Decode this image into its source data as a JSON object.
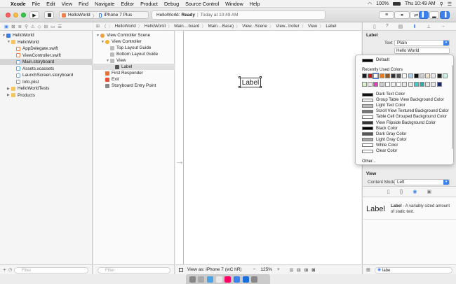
{
  "menubar": {
    "apple": "",
    "app": "Xcode",
    "items": [
      "File",
      "Edit",
      "View",
      "Find",
      "Navigate",
      "Editor",
      "Product",
      "Debug",
      "Source Control",
      "Window",
      "Help"
    ],
    "battery": "100%",
    "clock": "Thu 10:49 AM"
  },
  "toolbar": {
    "scheme_project": "HelloWorld",
    "scheme_device": "iPhone 7 Plus",
    "status_project": "HelloWorld:",
    "status_state": "Ready",
    "status_sep": "|",
    "status_time": "Today at 10:49 AM"
  },
  "navigator": {
    "rows": [
      {
        "label": "HelloWorld",
        "indent": 0,
        "kind": "proj",
        "disclosure": "▼",
        "selected": false
      },
      {
        "label": "HelloWorld",
        "indent": 1,
        "kind": "folder",
        "disclosure": "▼",
        "selected": false
      },
      {
        "label": "AppDelegate.swift",
        "indent": 2,
        "kind": "swift",
        "disclosure": "",
        "selected": false
      },
      {
        "label": "ViewController.swift",
        "indent": 2,
        "kind": "swift",
        "disclosure": "",
        "selected": false
      },
      {
        "label": "Main.storyboard",
        "indent": 2,
        "kind": "story",
        "disclosure": "",
        "selected": true
      },
      {
        "label": "Assets.xcassets",
        "indent": 2,
        "kind": "xcass",
        "disclosure": "",
        "selected": false
      },
      {
        "label": "LaunchScreen.storyboard",
        "indent": 2,
        "kind": "story",
        "disclosure": "",
        "selected": false
      },
      {
        "label": "Info.plist",
        "indent": 2,
        "kind": "plist",
        "disclosure": "",
        "selected": false
      },
      {
        "label": "HelloWorldTests",
        "indent": 1,
        "kind": "folder",
        "disclosure": "▶",
        "selected": false
      },
      {
        "label": "Products",
        "indent": 1,
        "kind": "folder",
        "disclosure": "▶",
        "selected": false
      }
    ],
    "filter_placeholder": "Filter"
  },
  "jumpbar": {
    "crumbs": [
      "HelloWorld",
      "HelloWorld",
      "Main....board",
      "Main....Base)",
      "View...Scene",
      "View...troller",
      "View",
      "Label"
    ]
  },
  "outline": {
    "rows": [
      {
        "label": "View Controller Scene",
        "indent": 0,
        "disclosure": "▼",
        "icon": "#f0a040",
        "selected": false
      },
      {
        "label": "View Controller",
        "indent": 1,
        "disclosure": "▼",
        "icon": "#f2b233",
        "selected": false
      },
      {
        "label": "Top Layout Guide",
        "indent": 2,
        "disclosure": "",
        "icon": "#bbbbbb",
        "selected": false
      },
      {
        "label": "Bottom Layout Guide",
        "indent": 2,
        "disclosure": "",
        "icon": "#bbbbbb",
        "selected": false
      },
      {
        "label": "View",
        "indent": 2,
        "disclosure": "▼",
        "icon": "#bbbbbb",
        "selected": false
      },
      {
        "label": "Label",
        "indent": 3,
        "disclosure": "",
        "icon": "#555555",
        "selected": true
      },
      {
        "label": "First Responder",
        "indent": 1,
        "disclosure": "",
        "icon": "#e8703a",
        "selected": false
      },
      {
        "label": "Exit",
        "indent": 1,
        "disclosure": "",
        "icon": "#e8503a",
        "selected": false
      },
      {
        "label": "Storyboard Entry Point",
        "indent": 1,
        "disclosure": "",
        "icon": "#888888",
        "selected": false
      }
    ],
    "filter_placeholder": "Filter"
  },
  "canvas": {
    "label_text": "Label",
    "view_as": "View as: iPhone 7 (wC hR)",
    "zoom": "125%"
  },
  "inspector": {
    "section": "Label",
    "text_label": "Text",
    "text_value": "Plain",
    "text_content": "Hello World",
    "view_section": "View",
    "content_mode_label": "Content Mode",
    "content_mode_value": "Left"
  },
  "color_popover": {
    "default_label": "Default",
    "recent_header": "Recently Used Colors",
    "recent_colors_row1": [
      "#1a1a1a",
      "#c41f1f",
      "#ffffff",
      "#e67e22",
      "#8a5a2b",
      "#333333",
      "#555555",
      "#ffffff",
      "#a9d0f5",
      "#111111",
      "#cfcfcf",
      "#f5e6c8",
      "#e9e9e9",
      "#222222",
      "#c9f2e6"
    ],
    "recent_colors_row2": [
      "#d9f5c4",
      "#e9e9e9",
      "#e040c0",
      "#d0d0d0",
      "#ffffff",
      "#f0f0f0",
      "#ffffff",
      "#e9e9e9",
      "#e9e9e9",
      "#3bd0d0",
      "#2bb0b0",
      "#e9e9e9",
      "#e9e9e9",
      "#1b2a6b"
    ],
    "system_colors": [
      {
        "name": "Dark Text Color",
        "swatch": "#111111"
      },
      {
        "name": "Group Table View Background Color",
        "swatch": "#eeeeee"
      },
      {
        "name": "Light Text Color",
        "swatch": "#bbbbbb"
      },
      {
        "name": "Scroll View Textured Background Color",
        "swatch": "#777777"
      },
      {
        "name": "Table Cell Grouped Background Color",
        "swatch": "#ffffff"
      },
      {
        "name": "View Flipside Background Color",
        "swatch": "#333333"
      },
      {
        "name": "Black Color",
        "swatch": "#000000"
      },
      {
        "name": "Dark Gray Color",
        "swatch": "#555555"
      },
      {
        "name": "Light Gray Color",
        "swatch": "#aaaaaa"
      },
      {
        "name": "White Color",
        "swatch": "#ffffff"
      },
      {
        "name": "Clear Color",
        "swatch": "#ffffff"
      }
    ],
    "other_label": "Other..."
  },
  "library": {
    "item_title": "Label",
    "item_desc_bold": "Label",
    "item_desc": " - A variably sized amount of static text.",
    "search_value": "labe"
  },
  "colors": {
    "accent": "#3b82f0",
    "selection": "#d4d4d4"
  }
}
